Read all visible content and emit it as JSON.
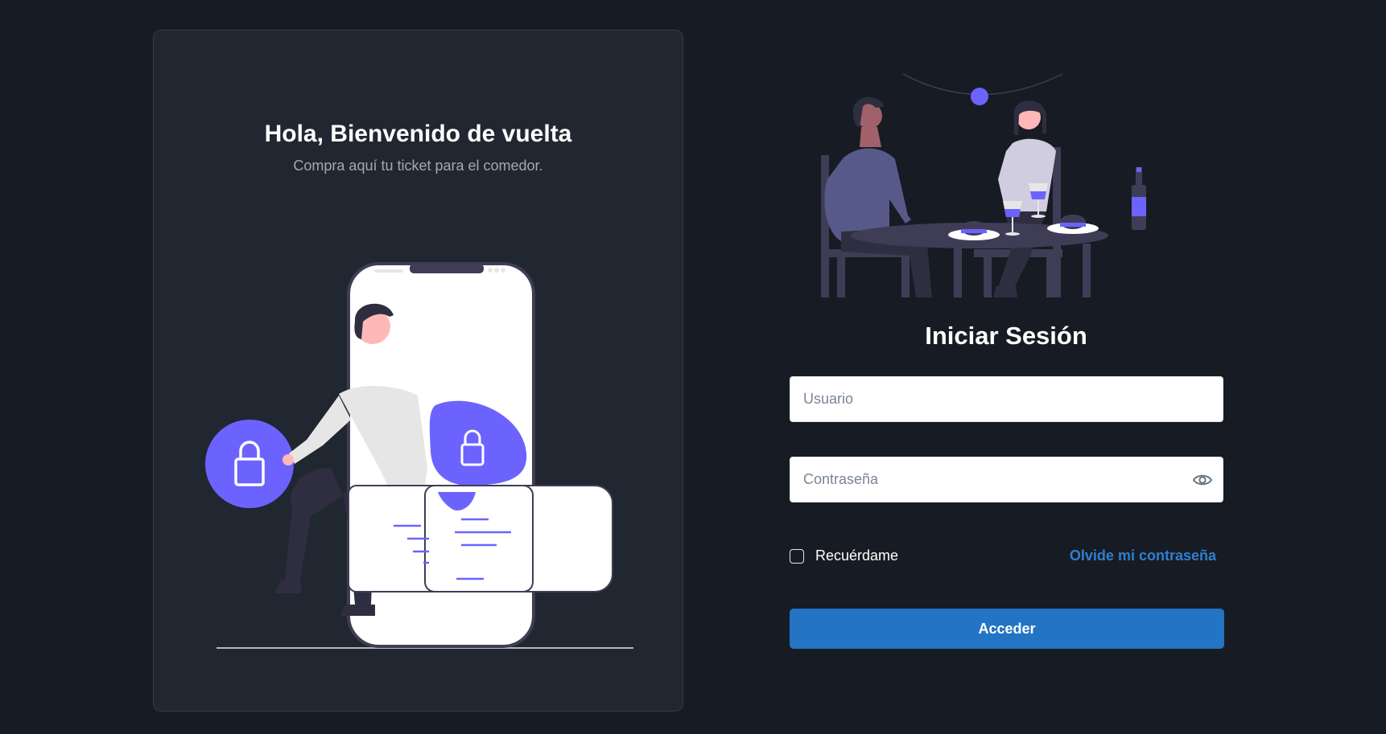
{
  "welcome": {
    "title": "Hola, Bienvenido de vuelta",
    "subtitle": "Compra aquí tu ticket para el comedor."
  },
  "login": {
    "title": "Iniciar Sesión",
    "username_placeholder": "Usuario",
    "password_placeholder": "Contraseña",
    "remember_label": "Recuérdame",
    "forgot_label": "Olvide mi contraseña",
    "submit_label": "Acceder"
  },
  "colors": {
    "background": "#171c24",
    "card": "#212731",
    "accent_illustration": "#6c63ff",
    "primary_button": "#2374c4",
    "link": "#2f7fd1"
  },
  "icons": {
    "password_toggle": "eye-icon",
    "illustration_left": "lock-icon",
    "illustration_right": "dinner-illustration"
  }
}
